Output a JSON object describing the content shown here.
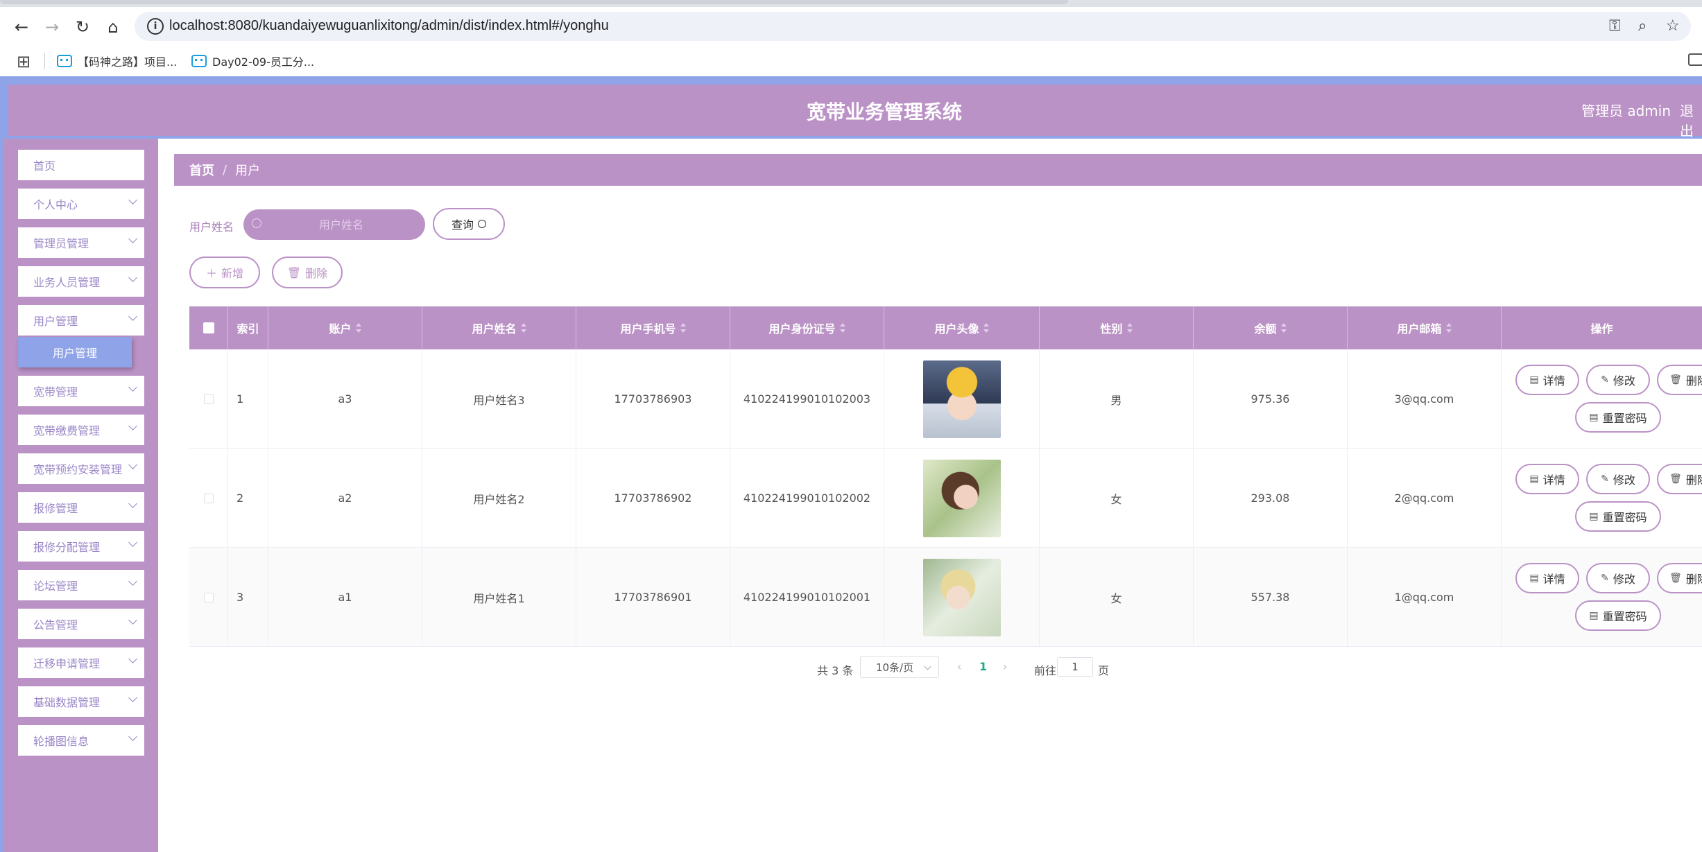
{
  "browser": {
    "url": "localhost:8080/kuandaiyewuguanlixitong/admin/dist/index.html#/yonghu",
    "bookmarks": [
      "【码神之路】项目...",
      "Day02-09-员工分..."
    ]
  },
  "header": {
    "title": "宽带业务管理系统",
    "admin_label": "管理员 admin",
    "logout": "退出"
  },
  "sidebar": {
    "items": [
      {
        "label": "首页"
      },
      {
        "label": "个人中心"
      },
      {
        "label": "管理员管理"
      },
      {
        "label": "业务人员管理"
      },
      {
        "label": "用户管理"
      },
      {
        "label": "宽带管理"
      },
      {
        "label": "宽带缴费管理"
      },
      {
        "label": "宽带预约安装管理"
      },
      {
        "label": "报修管理"
      },
      {
        "label": "报修分配管理"
      },
      {
        "label": "论坛管理"
      },
      {
        "label": "公告管理"
      },
      {
        "label": "迁移申请管理"
      },
      {
        "label": "基础数据管理"
      },
      {
        "label": "轮播图信息"
      }
    ],
    "active_submenu": "用户管理"
  },
  "breadcrumb": {
    "home": "首页",
    "separator": "/",
    "current": "用户"
  },
  "search": {
    "label": "用户姓名",
    "placeholder": "用户姓名",
    "query_button": "查询"
  },
  "actions": {
    "add": "新增",
    "delete": "删除"
  },
  "table": {
    "columns": [
      "索引",
      "账户",
      "用户姓名",
      "用户手机号",
      "用户身份证号",
      "用户头像",
      "性别",
      "余额",
      "用户邮箱",
      "操作"
    ],
    "rows": [
      {
        "index": "1",
        "account": "a3",
        "name": "用户姓名3",
        "phone": "17703786903",
        "id_card": "410224199010102003",
        "gender": "男",
        "balance": "975.36",
        "email": "3@qq.com"
      },
      {
        "index": "2",
        "account": "a2",
        "name": "用户姓名2",
        "phone": "17703786902",
        "id_card": "410224199010102002",
        "gender": "女",
        "balance": "293.08",
        "email": "2@qq.com"
      },
      {
        "index": "3",
        "account": "a1",
        "name": "用户姓名1",
        "phone": "17703786901",
        "id_card": "410224199010102001",
        "gender": "女",
        "balance": "557.38",
        "email": "1@qq.com"
      }
    ],
    "row_actions": {
      "detail": "详情",
      "edit": "修改",
      "delete": "删除",
      "reset_password": "重置密码"
    }
  },
  "pagination": {
    "total": "共 3 条",
    "page_size": "10条/页",
    "current_page": "1",
    "goto_label": "前往",
    "goto_value": "1",
    "page_suffix": "页"
  },
  "colors": {
    "theme": "#bb92c6",
    "accent": "#8fa3e8",
    "active_page": "#20a88a"
  }
}
